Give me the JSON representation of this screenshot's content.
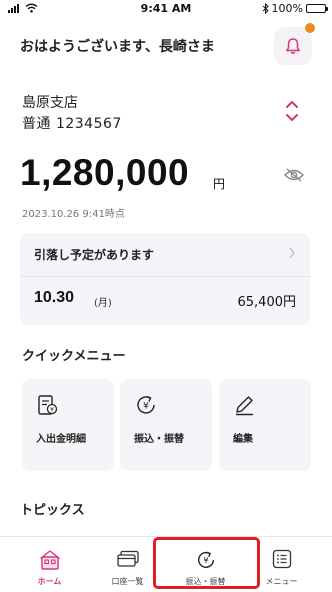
{
  "status_bar": {
    "time": "9:41 AM",
    "battery": "100%"
  },
  "header": {
    "greeting": "おはようございます、長崎さま"
  },
  "account": {
    "branch": "島原支店",
    "type_number": "普通  1234567",
    "balance": "1,280,000",
    "unit": "円",
    "timestamp": "2023.10.26  9:41時点"
  },
  "debit_card": {
    "title": "引落し予定があります",
    "date": "10.30",
    "day_of_week": "(月)",
    "amount": "65,400円"
  },
  "quick_menu": {
    "title": "クイックメニュー",
    "items": [
      {
        "label": "入出金明細",
        "icon": "statement-icon"
      },
      {
        "label": "振込・振替",
        "icon": "yen-transfer-icon"
      },
      {
        "label": "編集",
        "icon": "pencil-icon"
      }
    ]
  },
  "topics": {
    "title": "トピックス"
  },
  "tab_bar": {
    "tabs": [
      {
        "label": "ホーム",
        "icon": "home-icon",
        "active": true
      },
      {
        "label": "口座一覧",
        "icon": "card-icon",
        "active": false
      },
      {
        "label": "振込・振替",
        "icon": "yen-transfer-icon",
        "active": false
      },
      {
        "label": "メニュー",
        "icon": "menu-list-icon",
        "active": false
      }
    ]
  },
  "colors": {
    "accent": "#d6337f",
    "notification_dot": "#f08a1f",
    "card_background": "#f6f4f8",
    "highlight_box": "#e0201f"
  }
}
